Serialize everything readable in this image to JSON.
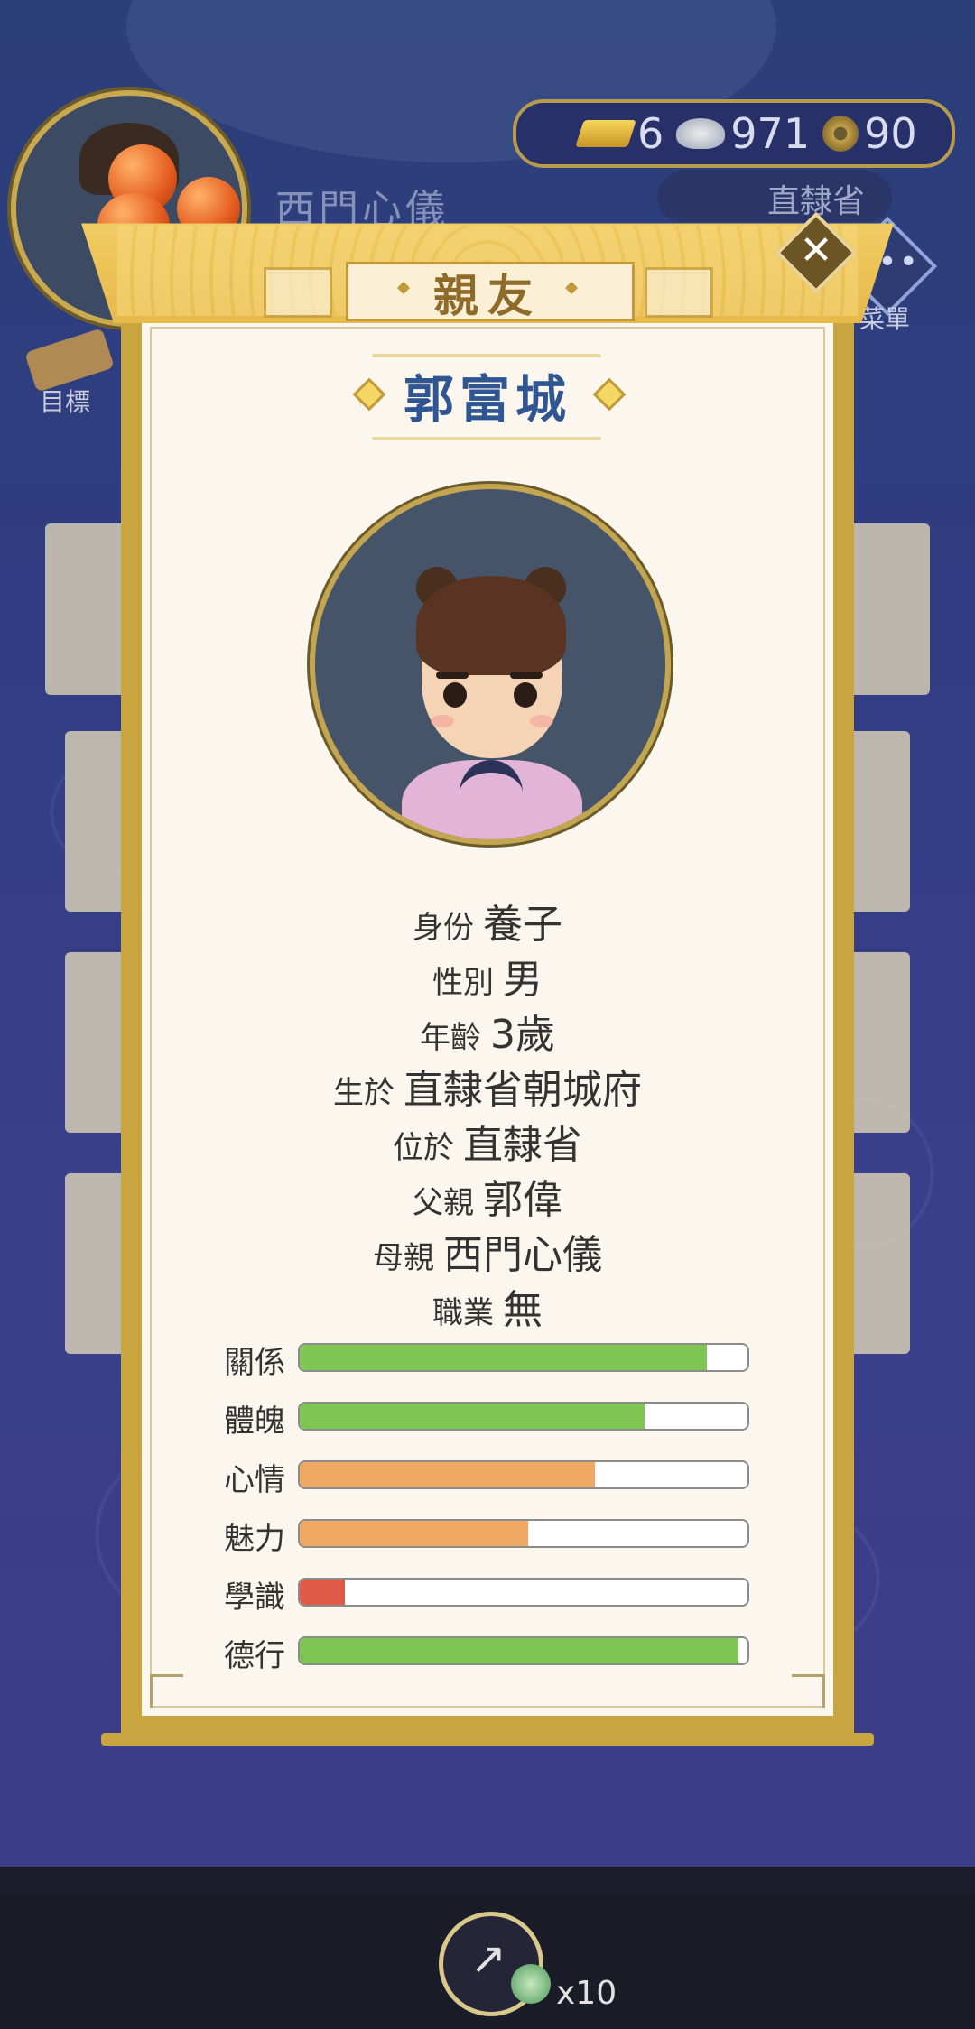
{
  "hud": {
    "player_name": "西門心儀",
    "currency": {
      "gold": "6",
      "silver": "971",
      "copper": "90"
    },
    "region_button": "直隸省",
    "menu_label": "菜單",
    "goal_label": "目標"
  },
  "dialog": {
    "title": "親友",
    "person_name": "郭富城",
    "info": [
      {
        "key": "身份",
        "value": "養子"
      },
      {
        "key": "性別",
        "value": "男"
      },
      {
        "key": "年齡",
        "value": "3歲"
      },
      {
        "key": "生於",
        "value": "直隸省朝城府"
      },
      {
        "key": "位於",
        "value": "直隸省"
      },
      {
        "key": "父親",
        "value": "郭偉"
      },
      {
        "key": "母親",
        "value": "西門心儀"
      },
      {
        "key": "職業",
        "value": "無"
      }
    ],
    "stats": [
      {
        "label": "關係",
        "level": 0.91,
        "color": "#7dc653"
      },
      {
        "label": "體魄",
        "level": 0.77,
        "color": "#7dc653"
      },
      {
        "label": "心情",
        "level": 0.66,
        "color": "#f0a863"
      },
      {
        "label": "魅力",
        "level": 0.51,
        "color": "#f0a863"
      },
      {
        "label": "學識",
        "level": 0.1,
        "color": "#e05a48"
      },
      {
        "label": "德行",
        "level": 0.98,
        "color": "#7dc653"
      }
    ]
  },
  "bottom": {
    "share_count": "x10"
  }
}
